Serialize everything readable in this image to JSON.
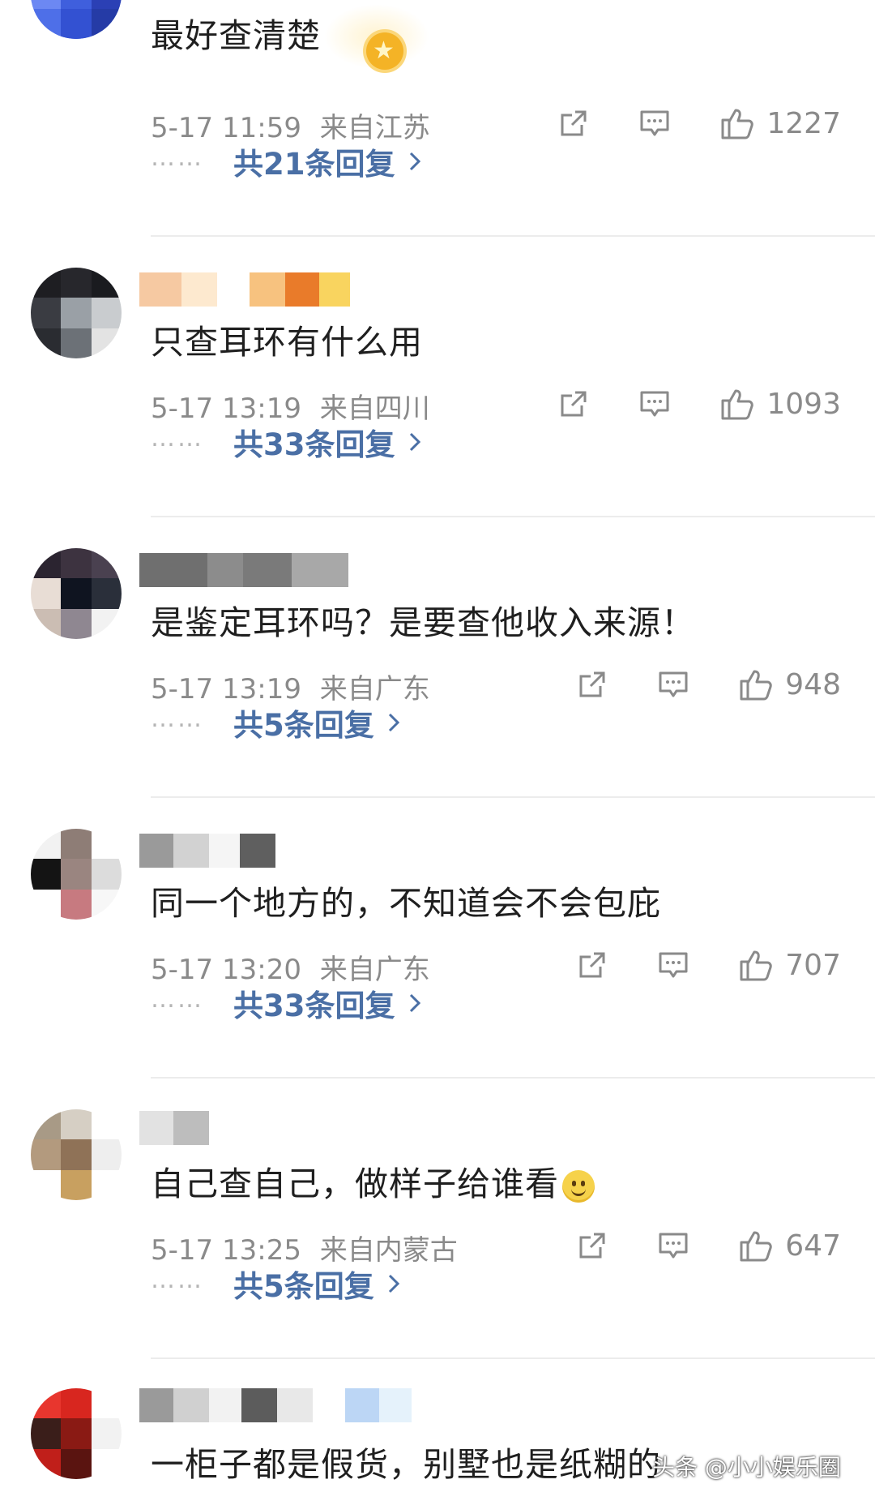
{
  "comments": [
    {
      "text": "最好查清楚",
      "time": "5-17 11:59",
      "location": "来自江苏",
      "likes": "1227",
      "replies": "共21条回复"
    },
    {
      "text": "只查耳环有什么用",
      "time": "5-17 13:19",
      "location": "来自四川",
      "likes": "1093",
      "replies": "共33条回复"
    },
    {
      "text": "是鉴定耳环吗？是要查他收入来源！",
      "time": "5-17 13:19",
      "location": "来自广东",
      "likes": "948",
      "replies": "共5条回复"
    },
    {
      "text": "同一个地方的，不知道会不会包庇",
      "time": "5-17 13:20",
      "location": "来自广东",
      "likes": "707",
      "replies": "共33条回复"
    },
    {
      "text": "自己查自己，做样子给谁看",
      "time": "5-17 13:25",
      "location": "来自内蒙古",
      "likes": "647",
      "replies": "共5条回复"
    },
    {
      "text": "一柜子都是假货，别墅也是纸糊的"
    }
  ],
  "reply_prefix": "……",
  "watermark": "头条 @小小娱乐圈",
  "icons": {
    "share": "share-icon",
    "comment": "comment-icon",
    "like": "thumbs-up-icon",
    "reply_arrow": "chevron-right-icon",
    "badge": "fan-badge-icon",
    "emoji": "smile-emoji-icon"
  },
  "colors": {
    "text": "#1f1f1f",
    "meta": "#8a8a8a",
    "link": "#4a6fa5",
    "divider": "#ececec"
  }
}
